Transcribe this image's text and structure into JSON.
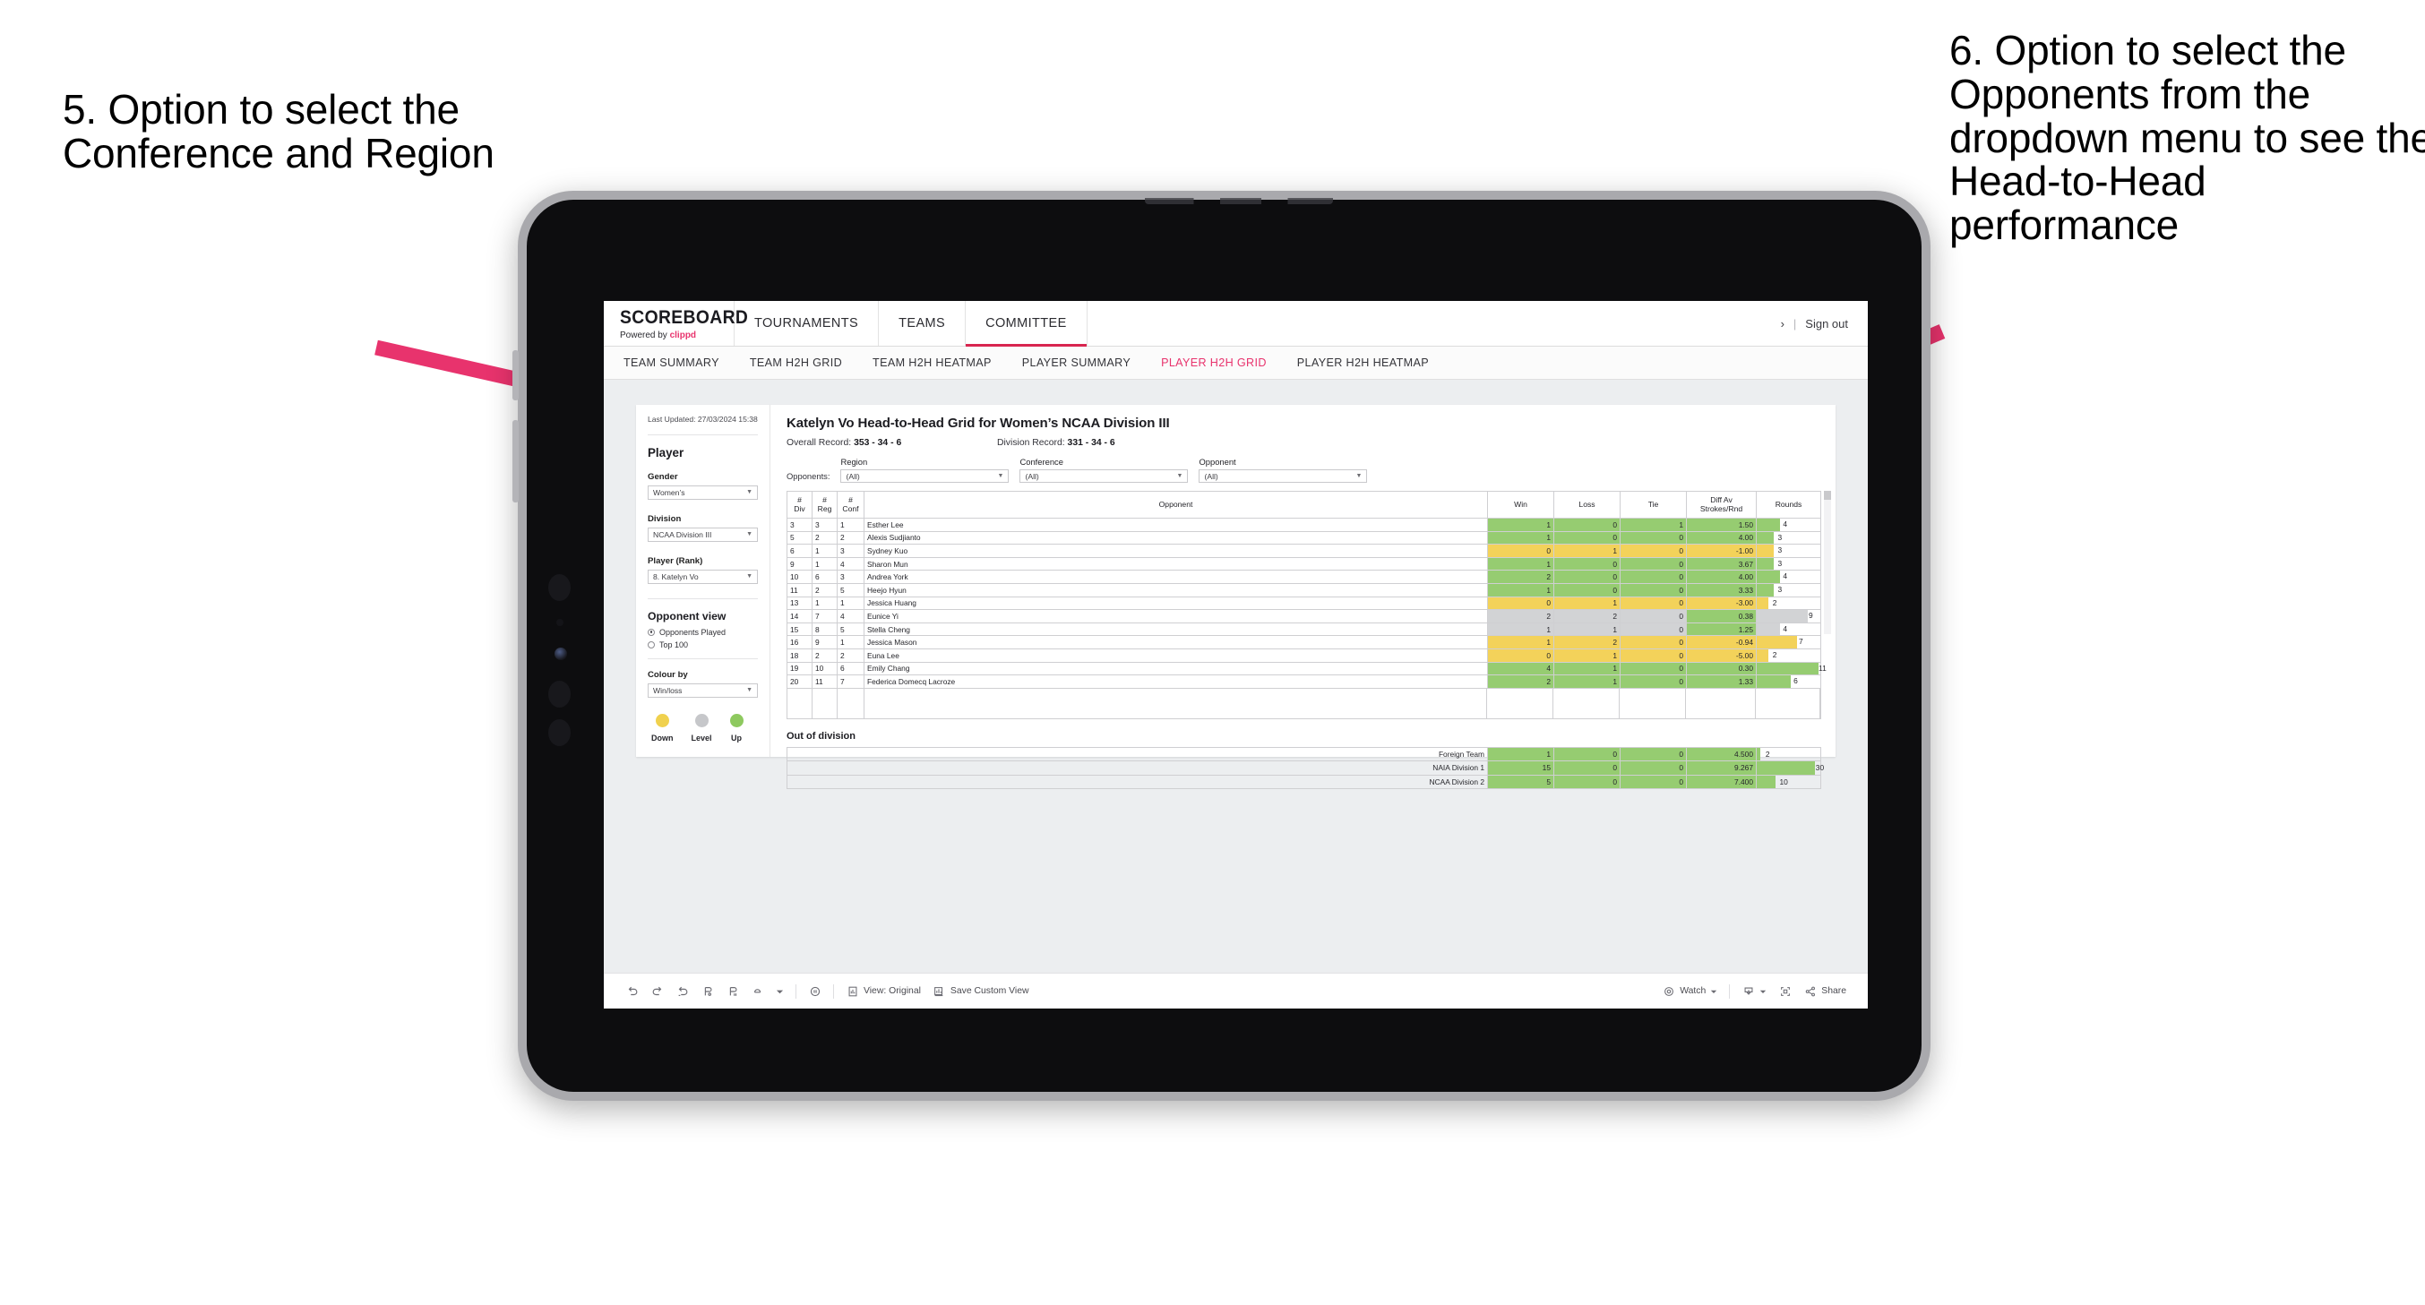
{
  "annotations": {
    "left": "5. Option to select the Conference and Region",
    "right": "6. Option to select the Opponents from the dropdown menu to see the Head-to-Head performance",
    "arrow_color": "#e8336d"
  },
  "topnav": {
    "brand_title": "SCOREBOARD",
    "brand_sub_prefix": "Powered by ",
    "brand_sub_brand": "clippd",
    "items": [
      {
        "label": "TOURNAMENTS",
        "active": false
      },
      {
        "label": "TEAMS",
        "active": false
      },
      {
        "label": "COMMITTEE",
        "active": true
      }
    ],
    "user_chevron": "›",
    "separator": "|",
    "sign_out": "Sign out"
  },
  "subnav": {
    "items": [
      {
        "label": "TEAM SUMMARY",
        "active": false
      },
      {
        "label": "TEAM H2H GRID",
        "active": false
      },
      {
        "label": "TEAM H2H HEATMAP",
        "active": false
      },
      {
        "label": "PLAYER SUMMARY",
        "active": false
      },
      {
        "label": "PLAYER H2H GRID",
        "active": true
      },
      {
        "label": "PLAYER H2H HEATMAP",
        "active": false
      }
    ],
    "active_color": "#e8336d"
  },
  "left_panel": {
    "last_updated": "Last Updated: 27/03/2024 15:38",
    "section_player": "Player",
    "filters": [
      {
        "label": "Gender",
        "value": "Women’s"
      },
      {
        "label": "Division",
        "value": "NCAA Division III"
      },
      {
        "label": "Player (Rank)",
        "value": "8. Katelyn Vo"
      }
    ],
    "opponent_view": {
      "title": "Opponent view",
      "options": [
        {
          "label": "Opponents Played",
          "selected": true
        },
        {
          "label": "Top 100",
          "selected": false
        }
      ]
    },
    "colour_by": {
      "label": "Colour by",
      "value": "Win/loss"
    },
    "legend": [
      {
        "label": "Down",
        "color": "#f0d14e"
      },
      {
        "label": "Level",
        "color": "#c6c7ca"
      },
      {
        "label": "Up",
        "color": "#8ec95f"
      }
    ]
  },
  "view": {
    "title": "Katelyn Vo Head-to-Head Grid for Women’s NCAA Division III",
    "overall_record_label": "Overall Record: ",
    "overall_record_value": "353 - 34 - 6",
    "division_record_label": "Division Record: ",
    "division_record_value": "331 - 34 - 6",
    "opponents_label": "Opponents:",
    "filters": [
      {
        "label": "Region",
        "value": "(All)"
      },
      {
        "label": "Conference",
        "value": "(All)"
      },
      {
        "label": "Opponent",
        "value": "(All)"
      }
    ]
  },
  "chart_data": {
    "type": "table",
    "title": "Katelyn Vo Head-to-Head Grid for Women’s NCAA Division III",
    "columns": [
      "# Div",
      "# Reg",
      "# Conf",
      "Opponent",
      "Win",
      "Loss",
      "Tie",
      "Diff Av Strokes/Rnd",
      "Rounds"
    ],
    "header_lines": [
      [
        "#",
        "Div"
      ],
      [
        "#",
        "Reg"
      ],
      [
        "#",
        "Conf"
      ],
      [
        "Opponent"
      ],
      [
        "Win"
      ],
      [
        "Loss"
      ],
      [
        "Tie"
      ],
      [
        "Diff Av",
        "Strokes/Rnd"
      ],
      [
        "Rounds"
      ]
    ],
    "rows": [
      {
        "div": "3",
        "reg": "3",
        "conf": "1",
        "opponent": "Esther Lee",
        "win": "1",
        "loss": "0",
        "tie": "1",
        "diff": "1.50",
        "rounds": "4",
        "state": "up",
        "bar_pct": 36
      },
      {
        "div": "5",
        "reg": "2",
        "conf": "2",
        "opponent": "Alexis Sudjianto",
        "win": "1",
        "loss": "0",
        "tie": "0",
        "diff": "4.00",
        "rounds": "3",
        "state": "up",
        "bar_pct": 27
      },
      {
        "div": "6",
        "reg": "1",
        "conf": "3",
        "opponent": "Sydney Kuo",
        "win": "0",
        "loss": "1",
        "tie": "0",
        "diff": "-1.00",
        "rounds": "3",
        "state": "down",
        "bar_pct": 27
      },
      {
        "div": "9",
        "reg": "1",
        "conf": "4",
        "opponent": "Sharon Mun",
        "win": "1",
        "loss": "0",
        "tie": "0",
        "diff": "3.67",
        "rounds": "3",
        "state": "up",
        "bar_pct": 27
      },
      {
        "div": "10",
        "reg": "6",
        "conf": "3",
        "opponent": "Andrea York",
        "win": "2",
        "loss": "0",
        "tie": "0",
        "diff": "4.00",
        "rounds": "4",
        "state": "up",
        "bar_pct": 36
      },
      {
        "div": "11",
        "reg": "2",
        "conf": "5",
        "opponent": "Heejo Hyun",
        "win": "1",
        "loss": "0",
        "tie": "0",
        "diff": "3.33",
        "rounds": "3",
        "state": "up",
        "bar_pct": 27
      },
      {
        "div": "13",
        "reg": "1",
        "conf": "1",
        "opponent": "Jessica Huang",
        "win": "0",
        "loss": "1",
        "tie": "0",
        "diff": "-3.00",
        "rounds": "2",
        "state": "down",
        "bar_pct": 18
      },
      {
        "div": "14",
        "reg": "7",
        "conf": "4",
        "opponent": "Eunice Yi",
        "win": "2",
        "loss": "2",
        "tie": "0",
        "diff": "0.38",
        "rounds": "9",
        "state": "level",
        "bar_pct": 80
      },
      {
        "div": "15",
        "reg": "8",
        "conf": "5",
        "opponent": "Stella Cheng",
        "win": "1",
        "loss": "1",
        "tie": "0",
        "diff": "1.25",
        "rounds": "4",
        "state": "level",
        "bar_pct": 36
      },
      {
        "div": "16",
        "reg": "9",
        "conf": "1",
        "opponent": "Jessica Mason",
        "win": "1",
        "loss": "2",
        "tie": "0",
        "diff": "-0.94",
        "rounds": "7",
        "state": "down",
        "bar_pct": 63
      },
      {
        "div": "18",
        "reg": "2",
        "conf": "2",
        "opponent": "Euna Lee",
        "win": "0",
        "loss": "1",
        "tie": "0",
        "diff": "-5.00",
        "rounds": "2",
        "state": "down",
        "bar_pct": 18
      },
      {
        "div": "19",
        "reg": "10",
        "conf": "6",
        "opponent": "Emily Chang",
        "win": "4",
        "loss": "1",
        "tie": "0",
        "diff": "0.30",
        "rounds": "11",
        "state": "up",
        "bar_pct": 97
      },
      {
        "div": "20",
        "reg": "11",
        "conf": "7",
        "opponent": "Federica Domecq Lacroze",
        "win": "2",
        "loss": "1",
        "tie": "0",
        "diff": "1.33",
        "rounds": "6",
        "state": "up",
        "bar_pct": 54
      }
    ],
    "out_of_division": {
      "title": "Out of division",
      "rows": [
        {
          "name": "Foreign Team",
          "win": "1",
          "loss": "0",
          "tie": "0",
          "diff": "4.500",
          "rounds": "2",
          "state": "up",
          "bar_pct": 6
        },
        {
          "name": "NAIA Division 1",
          "win": "15",
          "loss": "0",
          "tie": "0",
          "diff": "9.267",
          "rounds": "30",
          "state": "up",
          "bar_pct": 92
        },
        {
          "name": "NCAA Division 2",
          "win": "5",
          "loss": "0",
          "tie": "0",
          "diff": "7.400",
          "rounds": "10",
          "state": "up",
          "bar_pct": 30
        }
      ]
    },
    "colors": {
      "up": "#96cc71",
      "down": "#f3d25a",
      "level": "#d2d3d5"
    }
  },
  "toolbar": {
    "icons": [
      "undo-icon",
      "redo-icon",
      "revert-icon",
      "refresh-icon",
      "pause-icon",
      "collapse-icon"
    ],
    "view_label": "View: Original",
    "save_label": "Save Custom View",
    "watch_label": "Watch",
    "share_label": "Share",
    "download_icon": "download-icon",
    "fullscreen_icon": "fullscreen-icon"
  }
}
